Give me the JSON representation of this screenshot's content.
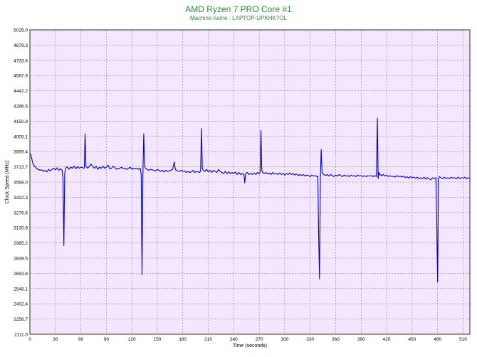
{
  "chart_data": {
    "type": "line",
    "title": "AMD Ryzen 7 PRO Core #1",
    "subtitle": "Machine name : LAPTOP-UPKHK7OL",
    "xlabel": "Time (seconds)",
    "ylabel": "Clock Speed (MHz)",
    "xlim": [
      0,
      518
    ],
    "ylim": [
      2111.0,
      5025.0
    ],
    "x_ticks": [
      0,
      30,
      60,
      90,
      120,
      150,
      180,
      210,
      240,
      270,
      300,
      330,
      360,
      390,
      420,
      450,
      480,
      510
    ],
    "x_tick_labels": [
      "0",
      "30",
      "60",
      "90",
      "120",
      "150",
      "180",
      "210",
      "240",
      "270",
      "300",
      "330",
      "360",
      "390",
      "420",
      "450",
      "480",
      "510"
    ],
    "y_ticks": [
      2111.0,
      2256.7,
      2402.4,
      2548.1,
      2693.8,
      2839.5,
      2985.2,
      3130.9,
      3276.6,
      3422.3,
      3568.0,
      3713.7,
      3859.4,
      4005.1,
      4150.8,
      4296.5,
      4442.2,
      4587.9,
      4733.6,
      4879.3,
      5025.0
    ],
    "y_tick_labels": [
      "2111.0",
      "2256.7",
      "2402.4",
      "2548.1",
      "2693.8",
      "2839.5",
      "2985.2",
      "3130.9",
      "3276.6",
      "3422.3",
      "3568.0",
      "3713.7",
      "3859.4",
      "4005.1",
      "4150.8",
      "4296.5",
      "4442.2",
      "4587.9",
      "4733.6",
      "4879.3",
      "5025.0"
    ],
    "grid": true,
    "colors": {
      "background": "#f5e6ff",
      "line": "#0000b4",
      "grid": "#7f7f7f",
      "title": "#2e8b2e",
      "axis_text": "#000000"
    },
    "series": [
      {
        "values_description_free": true,
        "points": [
          [
            0,
            3840
          ],
          [
            1,
            3830
          ],
          [
            2,
            3800
          ],
          [
            3,
            3760
          ],
          [
            4,
            3735
          ],
          [
            5,
            3725
          ],
          [
            6,
            3715
          ],
          [
            7,
            3705
          ],
          [
            8,
            3700
          ],
          [
            9,
            3690
          ],
          [
            10,
            3690
          ],
          [
            12,
            3680
          ],
          [
            14,
            3685
          ],
          [
            16,
            3670
          ],
          [
            18,
            3680
          ],
          [
            20,
            3665
          ],
          [
            22,
            3690
          ],
          [
            24,
            3675
          ],
          [
            26,
            3690
          ],
          [
            28,
            3700
          ],
          [
            30,
            3685
          ],
          [
            32,
            3705
          ],
          [
            34,
            3680
          ],
          [
            36,
            3695
          ],
          [
            38,
            3680
          ],
          [
            39,
            3600
          ],
          [
            40,
            2960
          ],
          [
            41,
            3650
          ],
          [
            42,
            3700
          ],
          [
            44,
            3715
          ],
          [
            46,
            3690
          ],
          [
            48,
            3710
          ],
          [
            50,
            3700
          ],
          [
            52,
            3720
          ],
          [
            54,
            3695
          ],
          [
            56,
            3715
          ],
          [
            58,
            3700
          ],
          [
            60,
            3710
          ],
          [
            62,
            3705
          ],
          [
            64,
            3700
          ],
          [
            65,
            4030
          ],
          [
            66,
            3720
          ],
          [
            68,
            3700
          ],
          [
            70,
            3720
          ],
          [
            72,
            3740
          ],
          [
            74,
            3715
          ],
          [
            76,
            3700
          ],
          [
            78,
            3720
          ],
          [
            80,
            3690
          ],
          [
            82,
            3710
          ],
          [
            84,
            3700
          ],
          [
            86,
            3720
          ],
          [
            88,
            3700
          ],
          [
            90,
            3710
          ],
          [
            92,
            3730
          ],
          [
            94,
            3695
          ],
          [
            96,
            3700
          ],
          [
            98,
            3720
          ],
          [
            100,
            3705
          ],
          [
            102,
            3690
          ],
          [
            104,
            3700
          ],
          [
            106,
            3700
          ],
          [
            108,
            3710
          ],
          [
            110,
            3695
          ],
          [
            112,
            3700
          ],
          [
            114,
            3690
          ],
          [
            116,
            3700
          ],
          [
            118,
            3710
          ],
          [
            120,
            3690
          ],
          [
            122,
            3700
          ],
          [
            124,
            3695
          ],
          [
            126,
            3700
          ],
          [
            128,
            3690
          ],
          [
            130,
            3700
          ],
          [
            131,
            3640
          ],
          [
            132,
            2680
          ],
          [
            133,
            3640
          ],
          [
            134,
            4030
          ],
          [
            135,
            3720
          ],
          [
            136,
            3700
          ],
          [
            138,
            3690
          ],
          [
            140,
            3680
          ],
          [
            142,
            3690
          ],
          [
            144,
            3685
          ],
          [
            146,
            3680
          ],
          [
            148,
            3675
          ],
          [
            150,
            3690
          ],
          [
            152,
            3680
          ],
          [
            154,
            3670
          ],
          [
            156,
            3680
          ],
          [
            158,
            3665
          ],
          [
            160,
            3680
          ],
          [
            162,
            3670
          ],
          [
            164,
            3675
          ],
          [
            166,
            3680
          ],
          [
            168,
            3690
          ],
          [
            170,
            3760
          ],
          [
            171,
            3700
          ],
          [
            172,
            3680
          ],
          [
            174,
            3675
          ],
          [
            176,
            3670
          ],
          [
            178,
            3680
          ],
          [
            180,
            3670
          ],
          [
            182,
            3675
          ],
          [
            184,
            3660
          ],
          [
            186,
            3670
          ],
          [
            188,
            3660
          ],
          [
            190,
            3665
          ],
          [
            192,
            3680
          ],
          [
            194,
            3660
          ],
          [
            196,
            3670
          ],
          [
            198,
            3665
          ],
          [
            200,
            3660
          ],
          [
            201,
            3680
          ],
          [
            202,
            4080
          ],
          [
            203,
            3700
          ],
          [
            204,
            3680
          ],
          [
            206,
            3670
          ],
          [
            208,
            3690
          ],
          [
            210,
            3665
          ],
          [
            212,
            3680
          ],
          [
            214,
            3660
          ],
          [
            216,
            3680
          ],
          [
            218,
            3670
          ],
          [
            220,
            3660
          ],
          [
            222,
            3690
          ],
          [
            224,
            3670
          ],
          [
            226,
            3660
          ],
          [
            228,
            3650
          ],
          [
            230,
            3670
          ],
          [
            232,
            3650
          ],
          [
            234,
            3665
          ],
          [
            236,
            3650
          ],
          [
            238,
            3660
          ],
          [
            240,
            3650
          ],
          [
            242,
            3665
          ],
          [
            244,
            3640
          ],
          [
            246,
            3660
          ],
          [
            248,
            3640
          ],
          [
            250,
            3650
          ],
          [
            252,
            3640
          ],
          [
            253,
            3560
          ],
          [
            254,
            3650
          ],
          [
            256,
            3660
          ],
          [
            258,
            3640
          ],
          [
            260,
            3650
          ],
          [
            262,
            3640
          ],
          [
            264,
            3655
          ],
          [
            266,
            3640
          ],
          [
            268,
            3660
          ],
          [
            270,
            3650
          ],
          [
            271,
            3660
          ],
          [
            272,
            4060
          ],
          [
            273,
            3680
          ],
          [
            274,
            3660
          ],
          [
            276,
            3650
          ],
          [
            278,
            3660
          ],
          [
            280,
            3645
          ],
          [
            282,
            3655
          ],
          [
            284,
            3640
          ],
          [
            286,
            3660
          ],
          [
            288,
            3645
          ],
          [
            290,
            3650
          ],
          [
            292,
            3640
          ],
          [
            294,
            3655
          ],
          [
            296,
            3640
          ],
          [
            298,
            3650
          ],
          [
            300,
            3635
          ],
          [
            302,
            3650
          ],
          [
            304,
            3640
          ],
          [
            306,
            3655
          ],
          [
            308,
            3640
          ],
          [
            310,
            3650
          ],
          [
            312,
            3635
          ],
          [
            314,
            3645
          ],
          [
            316,
            3630
          ],
          [
            318,
            3640
          ],
          [
            320,
            3630
          ],
          [
            322,
            3640
          ],
          [
            324,
            3625
          ],
          [
            326,
            3635
          ],
          [
            328,
            3630
          ],
          [
            330,
            3620
          ],
          [
            332,
            3635
          ],
          [
            334,
            3625
          ],
          [
            336,
            3630
          ],
          [
            338,
            3620
          ],
          [
            339,
            3625
          ],
          [
            340,
            3050
          ],
          [
            341,
            2640
          ],
          [
            342,
            3600
          ],
          [
            343,
            3880
          ],
          [
            344,
            3660
          ],
          [
            346,
            3640
          ],
          [
            348,
            3630
          ],
          [
            350,
            3640
          ],
          [
            352,
            3625
          ],
          [
            354,
            3640
          ],
          [
            356,
            3630
          ],
          [
            358,
            3620
          ],
          [
            360,
            3635
          ],
          [
            362,
            3625
          ],
          [
            364,
            3640
          ],
          [
            366,
            3630
          ],
          [
            368,
            3620
          ],
          [
            370,
            3635
          ],
          [
            372,
            3625
          ],
          [
            374,
            3630
          ],
          [
            376,
            3620
          ],
          [
            378,
            3635
          ],
          [
            380,
            3625
          ],
          [
            382,
            3630
          ],
          [
            384,
            3620
          ],
          [
            386,
            3635
          ],
          [
            388,
            3625
          ],
          [
            390,
            3630
          ],
          [
            392,
            3620
          ],
          [
            394,
            3630
          ],
          [
            396,
            3620
          ],
          [
            398,
            3630
          ],
          [
            400,
            3625
          ],
          [
            402,
            3630
          ],
          [
            404,
            3620
          ],
          [
            406,
            3630
          ],
          [
            408,
            3620
          ],
          [
            409,
            4180
          ],
          [
            410,
            3600
          ],
          [
            411,
            3660
          ],
          [
            412,
            3640
          ],
          [
            414,
            3630
          ],
          [
            416,
            3640
          ],
          [
            418,
            3625
          ],
          [
            420,
            3635
          ],
          [
            422,
            3620
          ],
          [
            424,
            3630
          ],
          [
            426,
            3620
          ],
          [
            428,
            3625
          ],
          [
            430,
            3615
          ],
          [
            432,
            3630
          ],
          [
            434,
            3620
          ],
          [
            436,
            3625
          ],
          [
            438,
            3615
          ],
          [
            440,
            3625
          ],
          [
            442,
            3610
          ],
          [
            444,
            3620
          ],
          [
            446,
            3605
          ],
          [
            448,
            3620
          ],
          [
            450,
            3610
          ],
          [
            452,
            3615
          ],
          [
            454,
            3605
          ],
          [
            456,
            3615
          ],
          [
            458,
            3600
          ],
          [
            460,
            3610
          ],
          [
            462,
            3600
          ],
          [
            464,
            3615
          ],
          [
            466,
            3595
          ],
          [
            468,
            3610
          ],
          [
            470,
            3600
          ],
          [
            472,
            3590
          ],
          [
            474,
            3610
          ],
          [
            476,
            3600
          ],
          [
            478,
            3610
          ],
          [
            479,
            3150
          ],
          [
            480,
            2610
          ],
          [
            481,
            3600
          ],
          [
            482,
            3620
          ],
          [
            484,
            3610
          ],
          [
            486,
            3600
          ],
          [
            488,
            3615
          ],
          [
            490,
            3600
          ],
          [
            492,
            3610
          ],
          [
            494,
            3600
          ],
          [
            496,
            3615
          ],
          [
            498,
            3605
          ],
          [
            500,
            3610
          ],
          [
            502,
            3600
          ],
          [
            504,
            3615
          ],
          [
            506,
            3600
          ],
          [
            508,
            3610
          ],
          [
            510,
            3605
          ],
          [
            512,
            3615
          ],
          [
            514,
            3600
          ],
          [
            516,
            3610
          ],
          [
            518,
            3600
          ]
        ]
      }
    ]
  }
}
